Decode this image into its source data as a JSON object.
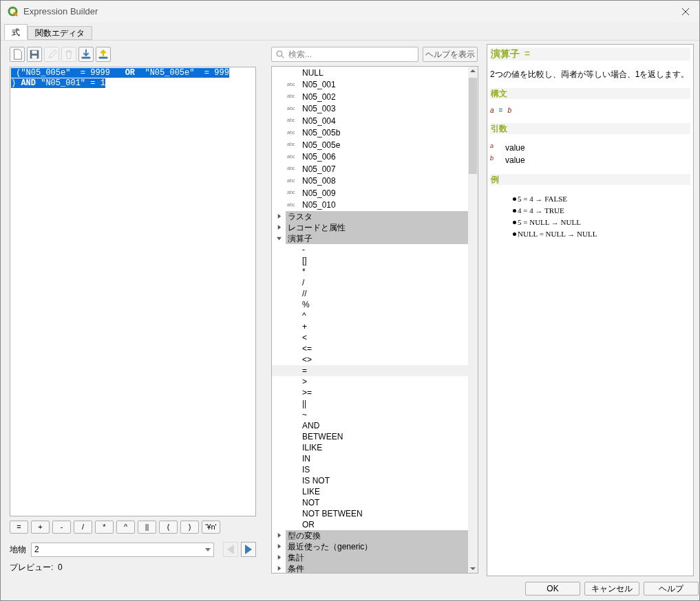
{
  "window": {
    "title": "Expression Builder"
  },
  "tabs": [
    {
      "label": "式",
      "selected": true
    },
    {
      "label": "関数エディタ",
      "selected": false
    }
  ],
  "toolbar": [
    {
      "kind": "new",
      "disabled": false
    },
    {
      "kind": "save",
      "disabled": false
    },
    {
      "kind": "edit",
      "disabled": true
    },
    {
      "kind": "delete",
      "disabled": true
    },
    {
      "kind": "import",
      "disabled": false
    },
    {
      "kind": "export",
      "disabled": false
    }
  ],
  "expression": {
    "selected": true,
    "lines": [
      " (\"N05_005e\"  = 9999   **OR**  \"N05_005e\"  = 999",
      ") **AND** \"N05_001\" = 1"
    ]
  },
  "operator_buttons": [
    "=",
    "+",
    "-",
    "/",
    "*",
    "^",
    "||",
    "(",
    ")",
    "'¥n'"
  ],
  "feature": {
    "label": "地物",
    "value": "2",
    "prev_disabled": true,
    "next_disabled": false
  },
  "preview": "プレビュー:  0",
  "search": {
    "placeholder": "検索..."
  },
  "show_help_button": "ヘルプを表示",
  "tree": {
    "items": [
      {
        "kind": "value",
        "label": "NULL",
        "selected": false
      },
      {
        "kind": "field",
        "type": "abc",
        "label": "N05_001",
        "selected": false
      },
      {
        "kind": "field",
        "type": "abc",
        "label": "N05_002",
        "selected": false
      },
      {
        "kind": "field",
        "type": "abc",
        "label": "N05_003",
        "selected": false
      },
      {
        "kind": "field",
        "type": "abc",
        "label": "N05_004",
        "selected": false
      },
      {
        "kind": "field",
        "type": "abc",
        "label": "N05_005b",
        "selected": false
      },
      {
        "kind": "field",
        "type": "abc",
        "label": "N05_005e",
        "selected": false
      },
      {
        "kind": "field",
        "type": "abc",
        "label": "N05_006",
        "selected": false
      },
      {
        "kind": "field",
        "type": "abc",
        "label": "N05_007",
        "selected": false
      },
      {
        "kind": "field",
        "type": "abc",
        "label": "N05_008",
        "selected": false
      },
      {
        "kind": "field",
        "type": "abc",
        "label": "N05_009",
        "selected": false
      },
      {
        "kind": "field",
        "type": "abc",
        "label": "N05_010",
        "selected": false
      }
    ],
    "groups": [
      {
        "label": "ラスタ",
        "expanded": false
      },
      {
        "label": "レコードと属性",
        "expanded": false
      },
      {
        "label": "演算子",
        "expanded": true,
        "children": [
          {
            "label": "-",
            "selected": false
          },
          {
            "label": "[]",
            "selected": false
          },
          {
            "label": "*",
            "selected": false
          },
          {
            "label": "/",
            "selected": false
          },
          {
            "label": "//",
            "selected": false
          },
          {
            "label": "%",
            "selected": false
          },
          {
            "label": "^",
            "selected": false
          },
          {
            "label": "+",
            "selected": false
          },
          {
            "label": "<",
            "selected": false
          },
          {
            "label": "<=",
            "selected": false
          },
          {
            "label": "<>",
            "selected": false
          },
          {
            "label": "=",
            "selected": true
          },
          {
            "label": ">",
            "selected": false
          },
          {
            "label": ">=",
            "selected": false
          },
          {
            "label": "||",
            "selected": false
          },
          {
            "label": "~",
            "selected": false
          },
          {
            "label": "AND",
            "selected": false
          },
          {
            "label": "BETWEEN",
            "selected": false
          },
          {
            "label": "ILIKE",
            "selected": false
          },
          {
            "label": "IN",
            "selected": false
          },
          {
            "label": "IS",
            "selected": false
          },
          {
            "label": "IS NOT",
            "selected": false
          },
          {
            "label": "LIKE",
            "selected": false
          },
          {
            "label": "NOT",
            "selected": false
          },
          {
            "label": "NOT BETWEEN",
            "selected": false
          },
          {
            "label": "OR",
            "selected": false
          }
        ]
      },
      {
        "label": "型の変換",
        "expanded": false
      },
      {
        "label": "最近使った（generic）",
        "expanded": false
      },
      {
        "label": "集計",
        "expanded": false
      },
      {
        "label": "条件",
        "expanded": false
      }
    ]
  },
  "help": {
    "title": "演算子",
    "operator": "=",
    "description": "2つの値を比較し、両者が等しい場合、1を返します。",
    "sections": [
      {
        "kind": "syntax",
        "heading": "構文",
        "parts": [
          "a",
          "=",
          "b"
        ]
      },
      {
        "kind": "arguments",
        "heading": "引数",
        "arguments": [
          {
            "name": "a",
            "description": "value"
          },
          {
            "name": "b",
            "description": "value"
          }
        ]
      },
      {
        "kind": "examples",
        "heading": "例",
        "examples": [
          "5 = 4 → FALSE",
          "4 = 4 → TRUE",
          "5 = NULL → NULL",
          "NULL = NULL → NULL"
        ]
      }
    ]
  },
  "dialog_buttons": [
    "OK",
    "キャンセル",
    "ヘルプ"
  ]
}
